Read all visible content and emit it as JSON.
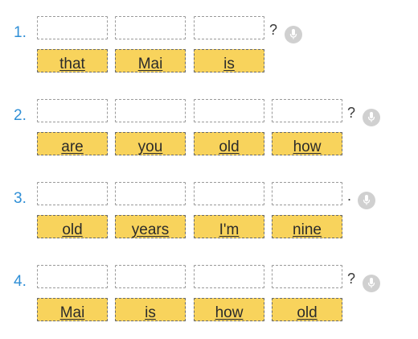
{
  "questions": [
    {
      "number": "1.",
      "punctuation": "?",
      "words": [
        "that",
        "Mai",
        "is"
      ]
    },
    {
      "number": "2.",
      "punctuation": "?",
      "words": [
        "are",
        "you",
        "old",
        "how"
      ]
    },
    {
      "number": "3.",
      "punctuation": ".",
      "words": [
        "old",
        "years",
        "I'm",
        "nine"
      ]
    },
    {
      "number": "4.",
      "punctuation": "?",
      "words": [
        "Mai",
        "is",
        "how",
        "old"
      ]
    }
  ],
  "icons": {
    "mic": "microphone-icon"
  },
  "colors": {
    "number": "#2f8fd6",
    "word_tile": "#f8d35c",
    "mic_button": "#d0d0d0"
  }
}
